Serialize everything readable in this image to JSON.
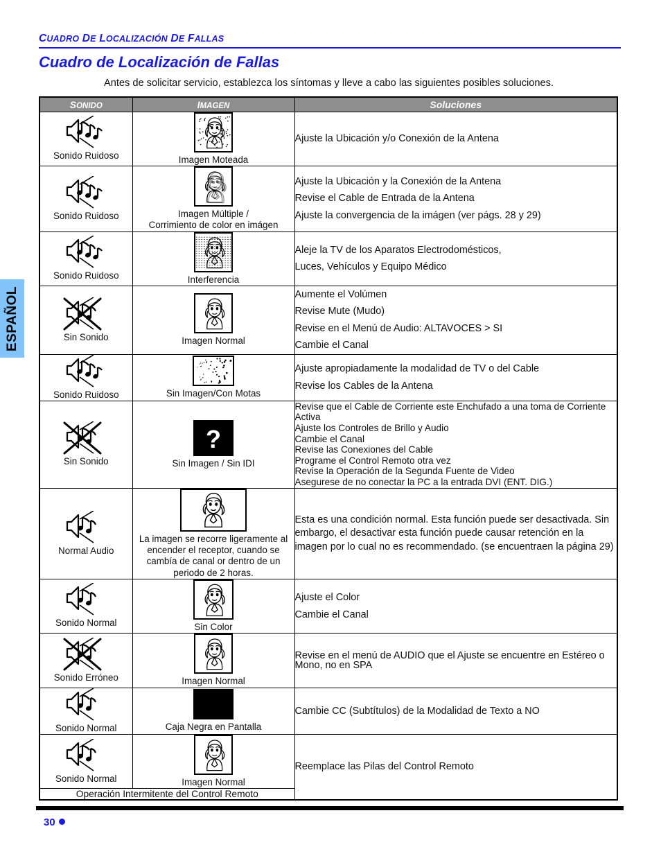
{
  "language_tab": {
    "label": "ESPAÑOL"
  },
  "header": {
    "kicker": "CUADRO DE LOCALIZACIÓN DE FALLAS",
    "title": "Cuadro de Localización de Fallas",
    "intro": "Antes de solicitar servicio, establezca los síntomas y lleve a cabo las siguientes posibles soluciones."
  },
  "table": {
    "columns": [
      "SONIDO",
      "IMAGEN",
      "Soluciones"
    ],
    "header_bg": "#8e8e8e",
    "header_color": "#ffffff",
    "rows": [
      {
        "sound_icon": "speaker-noisy-icon",
        "sound_label": "Sonido Ruidoso",
        "image_icon": "tv-speckled-picture-icon",
        "image_label": "Imagen Moteada",
        "solutions": [
          "Ajuste la Ubicación y/o Conexión de la Antena"
        ]
      },
      {
        "sound_icon": "speaker-noisy-icon",
        "sound_label": "Sonido Ruidoso",
        "image_icon": "tv-ghosting-picture-icon",
        "image_label": "Imagen Múltiple /\nCorrimiento de color en imágen",
        "solutions": [
          "Ajuste la Ubicación y la Conexión de la Antena",
          "Revise el Cable de Entrada de la Antena",
          "Ajuste la convergencia de la imágen (ver págs. 28 y 29)"
        ]
      },
      {
        "sound_icon": "speaker-noisy-icon",
        "sound_label": "Sonido Ruidoso",
        "image_icon": "tv-interference-picture-icon",
        "image_label": "Interferencia",
        "solutions": [
          "Aleje la TV de los Aparatos Electrodomésticos,",
          "Luces, Vehículos y Equipo Médico"
        ]
      },
      {
        "sound_icon": "speaker-muted-icon",
        "sound_label": "Sin Sonido",
        "image_icon": "tv-normal-picture-icon",
        "image_label": "Imagen Normal",
        "solutions": [
          "Aumente el Volúmen",
          "Revise Mute (Mudo)",
          "Revise en el Menú de Audio: ALTAVOCES > SI",
          "Cambie el Canal"
        ]
      },
      {
        "sound_icon": "speaker-noisy-icon",
        "sound_label": "Sonido Ruidoso",
        "image_icon": "tv-snow-picture-icon",
        "image_label": "Sin Imagen/Con Motas",
        "solutions": [
          "Ajuste apropiadamente la modalidad de TV o del Cable",
          "Revise los Cables de la Antena"
        ]
      },
      {
        "sound_icon": "speaker-muted-icon",
        "sound_label": "Sin Sonido",
        "image_icon": "tv-question-mark-icon",
        "image_label": "Sin Imagen / Sin IDI",
        "solutions": [
          "Revise que el Cable de Corriente este Enchufado a una toma de Corriente",
          "Activa",
          "Ajuste los Controles de Brillo y Audio",
          "Cambie el Canal",
          "Revise las Conexiones del Cable",
          "Programe el Control Remoto otra vez",
          "Revise la Operación de la Segunda Fuente de Video",
          "Asegurese de no conectar la PC a la entrada DVI (ENT. DIG.)"
        ]
      },
      {
        "sound_icon": "speaker-normal-icon",
        "sound_label": "Normal Audio",
        "image_icon": "tv-wide-normal-picture-icon",
        "image_label": "La imagen se recorre ligeramente al encender el receptor, cuando se cambía de canal or dentro de un periodo de 2 horas.",
        "solutions": [
          "Esta es una condición normal. Esta función puede ser desactivada. Sin embargo, el desactivar esta función puede causar retención en la imagen por lo cual no es recommendado. (se encuentraen la página 29)"
        ]
      },
      {
        "sound_icon": "speaker-normal-icon",
        "sound_label": "Sonido Normal",
        "image_icon": "tv-no-color-picture-icon",
        "image_label": "Sin Color",
        "solutions": [
          "Ajuste el Color",
          "Cambie el Canal"
        ]
      },
      {
        "sound_icon": "speaker-muted-icon",
        "sound_label": "Sonido Erróneo",
        "image_icon": "tv-normal-picture-icon",
        "image_label": "Imagen Normal",
        "solutions": [
          "Revise en el menú de AUDIO que el Ajuste se encuentre en Estéreo o Mono, no en SPA"
        ]
      },
      {
        "sound_icon": "speaker-normal-icon",
        "sound_label": "Sonido Normal",
        "image_icon": "tv-black-box-icon",
        "image_label": "Caja Negra en Pantalla",
        "solutions": [
          "Cambie CC (Subtítulos) de la Modalidad de Texto a NO"
        ]
      },
      {
        "sound_icon": "speaker-normal-icon",
        "sound_label": "Sonido Normal",
        "image_icon": "tv-normal-picture-icon",
        "image_label": "Imagen Normal",
        "merged_label": "Operación Intermitente del Control Remoto",
        "solutions": [
          "Reemplace las Pilas del Control Remoto"
        ]
      }
    ]
  },
  "footer": {
    "page_number": "30",
    "accent_color": "#1b1bdd"
  }
}
